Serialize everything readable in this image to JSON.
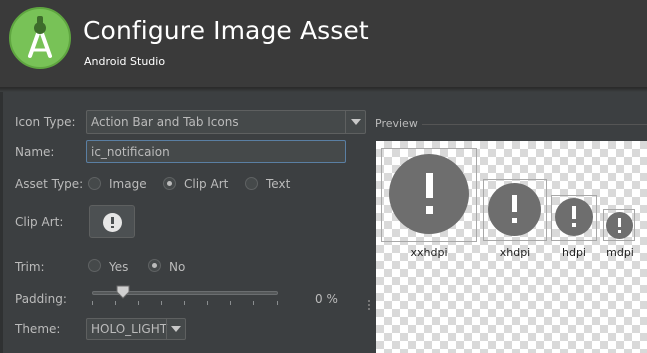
{
  "header": {
    "title": "Configure Image Asset",
    "subtitle": "Android Studio",
    "logo_icon": "android-studio-logo",
    "background": "#3a3a3a"
  },
  "form": {
    "icon_type": {
      "label": "Icon Type:",
      "value": "Action Bar and Tab Icons"
    },
    "name": {
      "label": "Name:",
      "value": "ic_notificaion"
    },
    "asset_type": {
      "label": "Asset Type:",
      "options": [
        "Image",
        "Clip Art",
        "Text"
      ],
      "selected": "Clip Art"
    },
    "clip_art": {
      "label": "Clip Art:",
      "icon": "alert-circle-icon"
    },
    "trim": {
      "label": "Trim:",
      "options": [
        "Yes",
        "No"
      ],
      "selected": "No"
    },
    "padding": {
      "label": "Padding:",
      "value_text": "0 %",
      "value_fraction": 0.13
    },
    "theme": {
      "label": "Theme:",
      "value": "HOLO_LIGHT"
    }
  },
  "preview": {
    "label": "Preview",
    "densities": [
      "xxhdpi",
      "xhdpi",
      "hdpi",
      "mdpi"
    ],
    "icon": "alert-circle-icon",
    "icon_color": "#6e6e6e"
  }
}
